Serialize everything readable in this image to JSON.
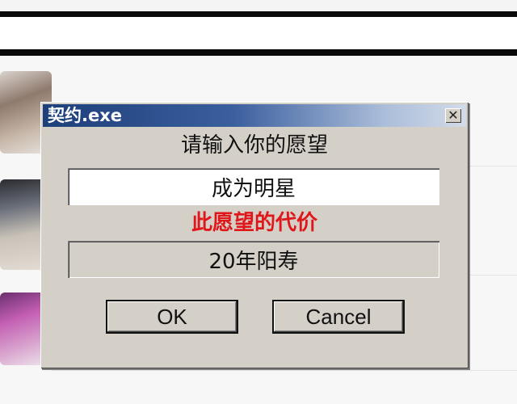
{
  "dialog": {
    "title": "契约.exe",
    "close_icon_glyph": "✕",
    "prompt": "请输入你的愿望",
    "wish_value": "成为明星",
    "cost_label": "此愿望的代价",
    "cost_value": "20年阳寿",
    "ok_label": "OK",
    "cancel_label": "Cancel"
  },
  "colors": {
    "titlebar_start": "#1d3f7a",
    "titlebar_end": "#d2dbe8",
    "dialog_face": "#d4d0c8",
    "cost_label": "#e0161a"
  }
}
